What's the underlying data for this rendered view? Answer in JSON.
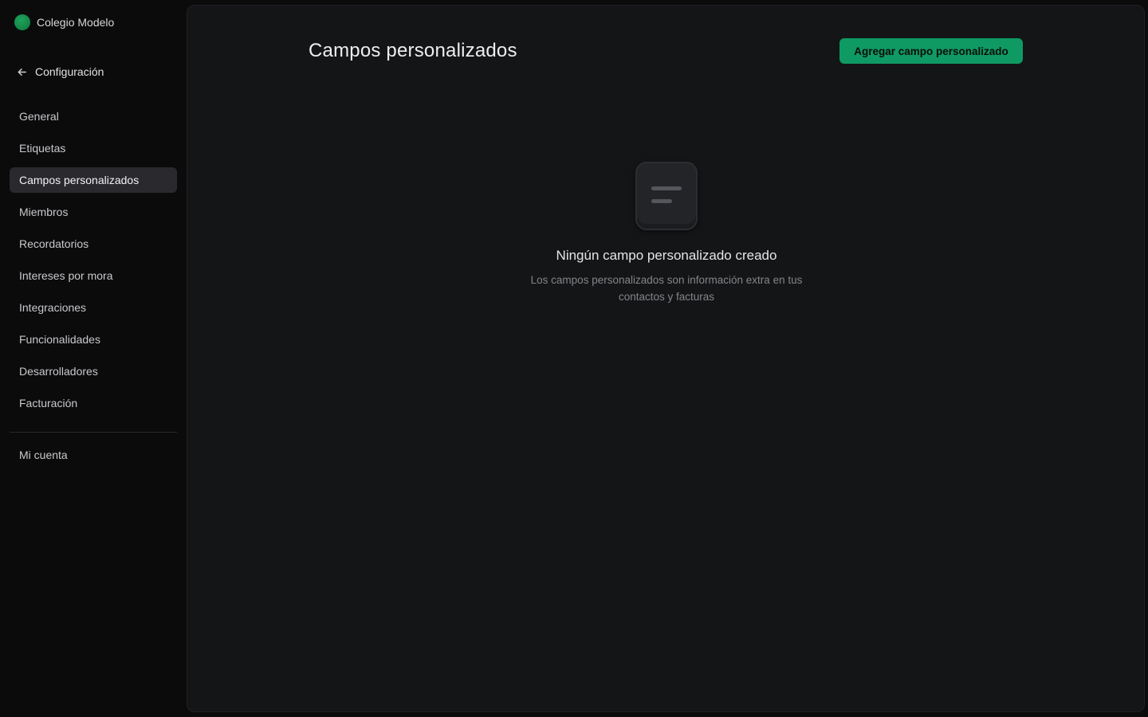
{
  "sidebar": {
    "org_name": "Colegio Modelo",
    "back_label": "Configuración",
    "items": [
      {
        "label": "General"
      },
      {
        "label": "Etiquetas"
      },
      {
        "label": "Campos personalizados",
        "active": true
      },
      {
        "label": "Miembros"
      },
      {
        "label": "Recordatorios"
      },
      {
        "label": "Intereses por mora"
      },
      {
        "label": "Integraciones"
      },
      {
        "label": "Funcionalidades"
      },
      {
        "label": "Desarrolladores"
      },
      {
        "label": "Facturación"
      }
    ],
    "bottom_items": [
      {
        "label": "Mi cuenta"
      }
    ]
  },
  "main": {
    "title": "Campos personalizados",
    "add_button_label": "Agregar campo personalizado",
    "empty_state": {
      "icon": "text-lines-icon",
      "title": "Ningún campo personalizado creado",
      "description": "Los campos personalizados son información extra en tus contactos y facturas"
    }
  },
  "colors": {
    "accent": "#0f9a63",
    "background": "#0b0b0c",
    "panel": "#141517",
    "active_item": "#2a2a2e"
  }
}
